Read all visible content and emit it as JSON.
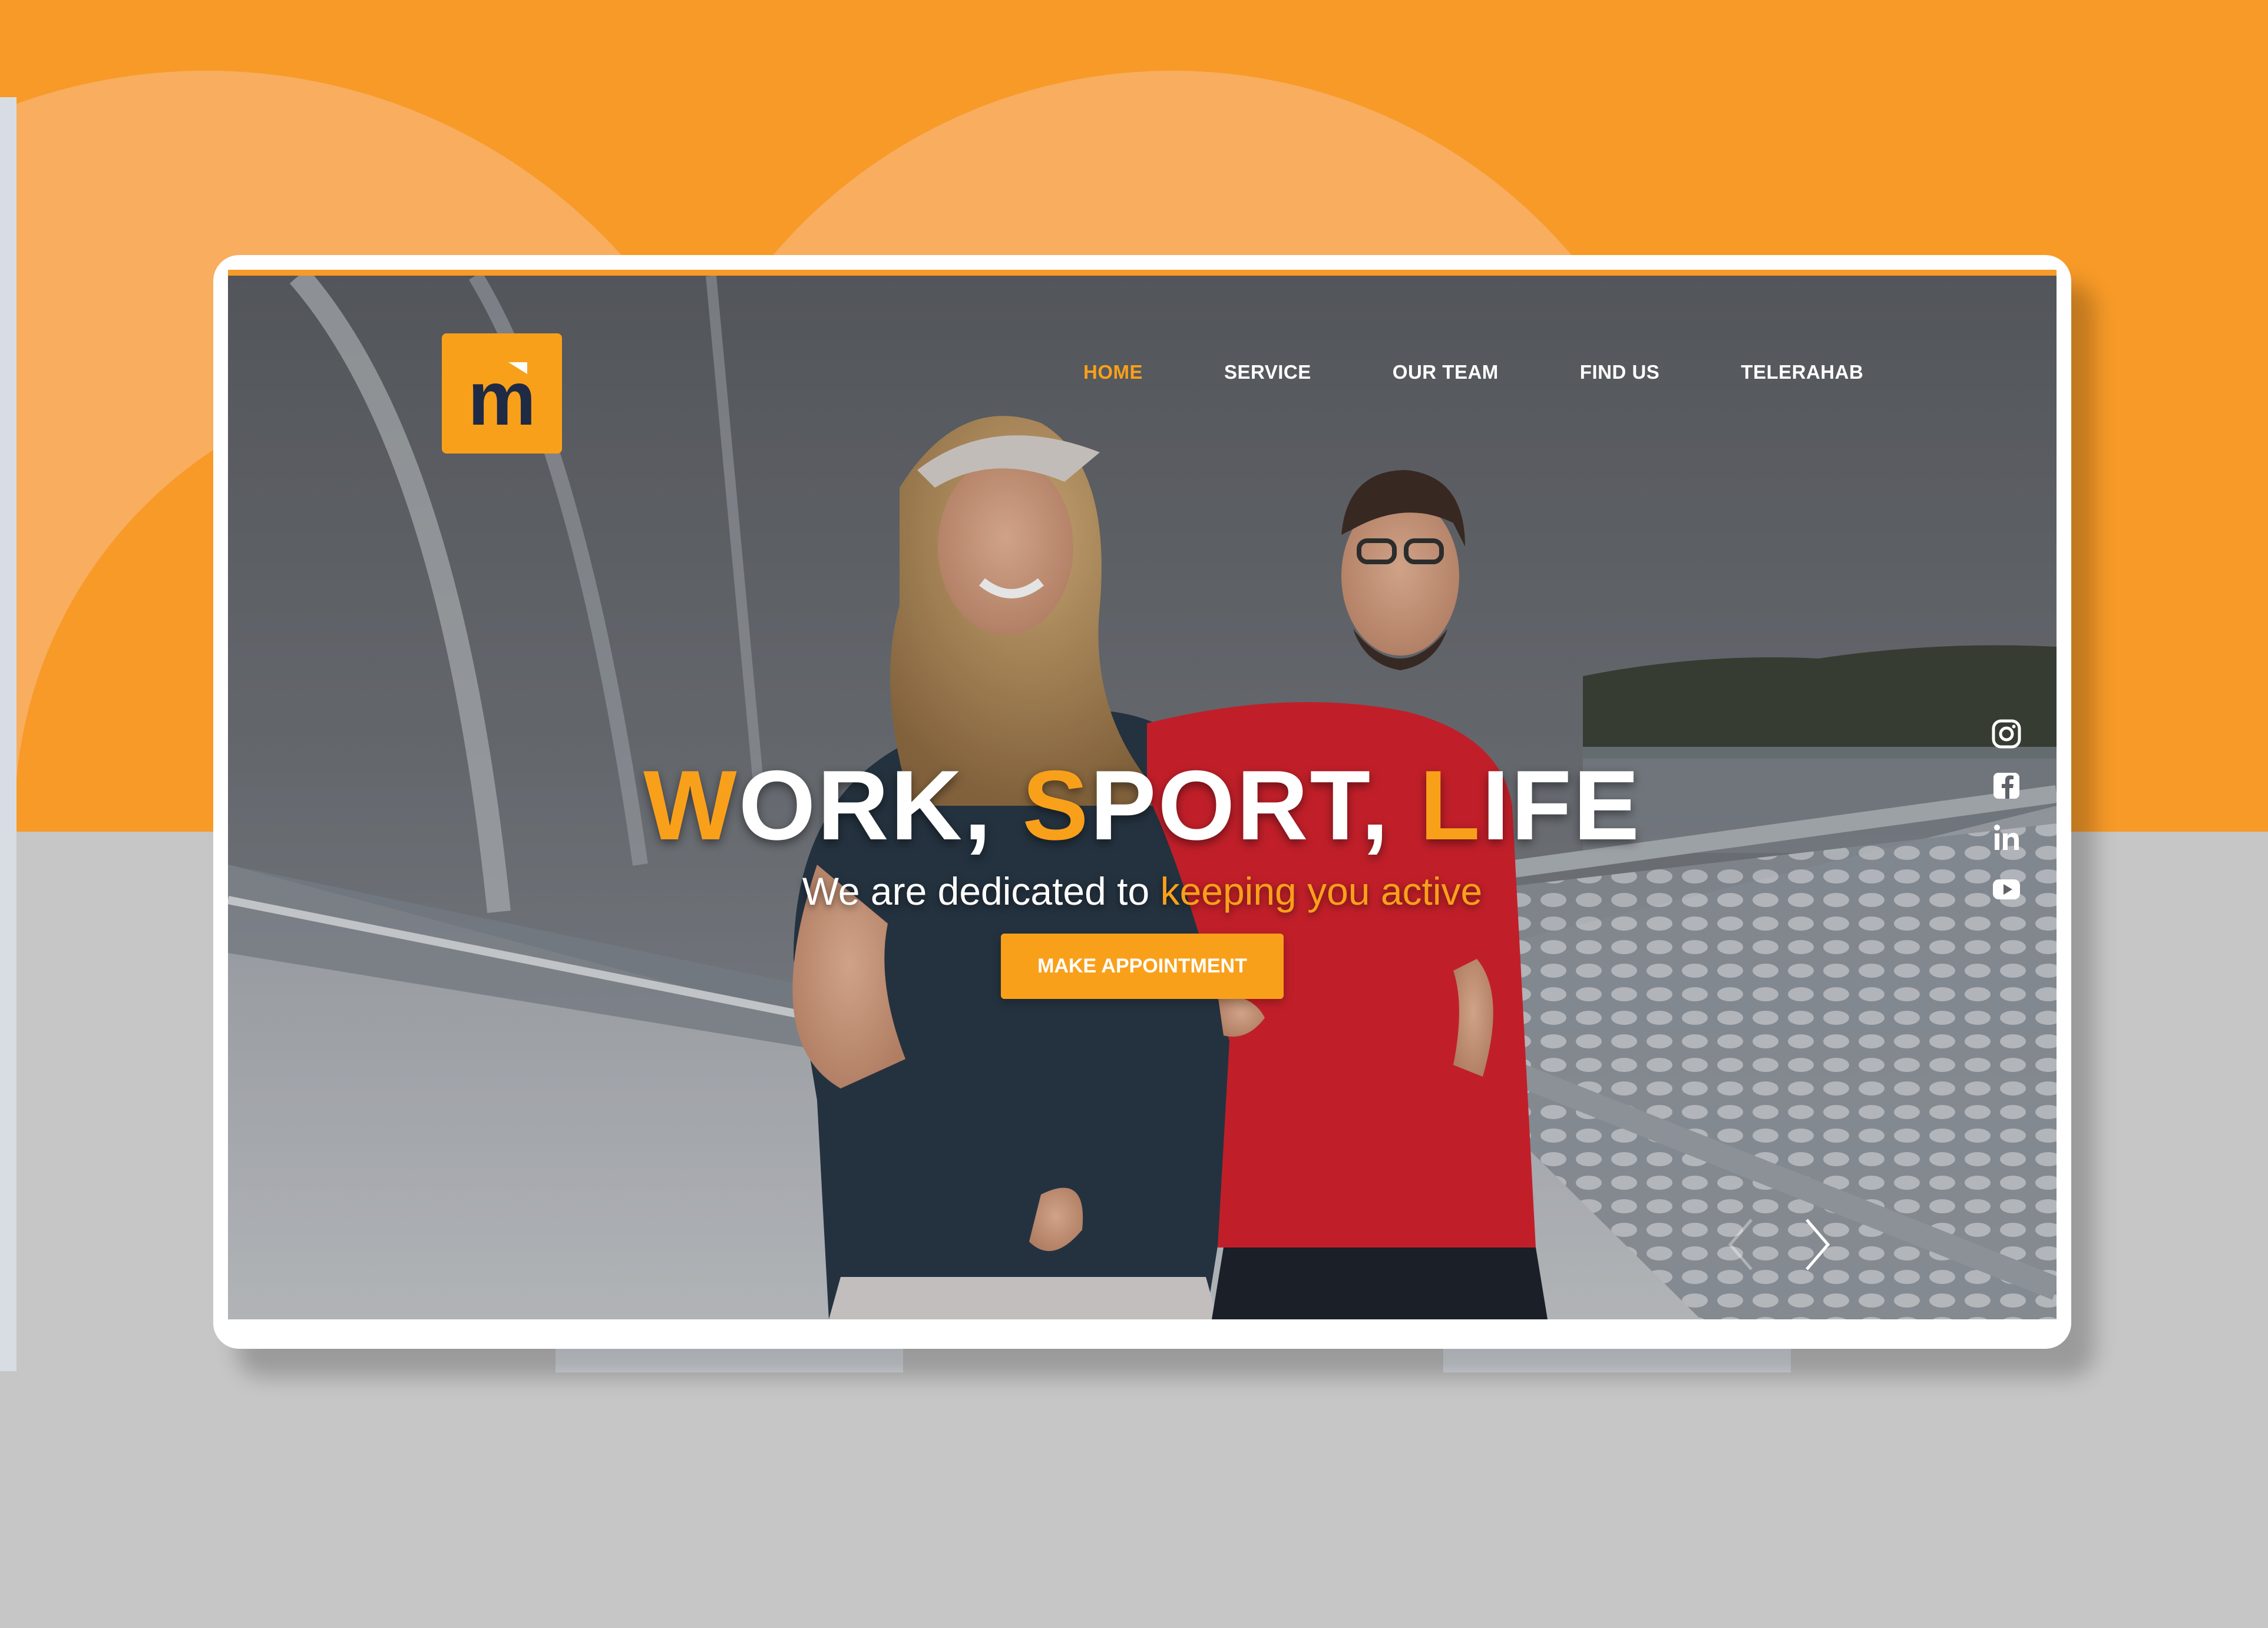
{
  "brand": {
    "logo_letter": "m",
    "accent_color": "#f9a01b",
    "background_orange": "#f79a28"
  },
  "nav": {
    "items": [
      {
        "label": "HOME",
        "active": true
      },
      {
        "label": "SERVICE",
        "active": false
      },
      {
        "label": "OUR TEAM",
        "active": false
      },
      {
        "label": "FIND US",
        "active": false
      },
      {
        "label": "TELERAHAB",
        "active": false
      }
    ]
  },
  "hero": {
    "headline": [
      {
        "accent": "W",
        "rest": "ORK, "
      },
      {
        "accent": "S",
        "rest": "PORT, "
      },
      {
        "accent": "L",
        "rest": "IFE"
      }
    ],
    "subline_plain": "We are dedicated to ",
    "subline_accent": "keeping you active",
    "cta_label": "MAKE APPOINTMENT"
  },
  "social": [
    "instagram-icon",
    "facebook-icon",
    "linkedin-icon",
    "youtube-icon"
  ],
  "carousel": {
    "prev_icon": "chevron-left-icon",
    "next_icon": "chevron-right-icon"
  }
}
